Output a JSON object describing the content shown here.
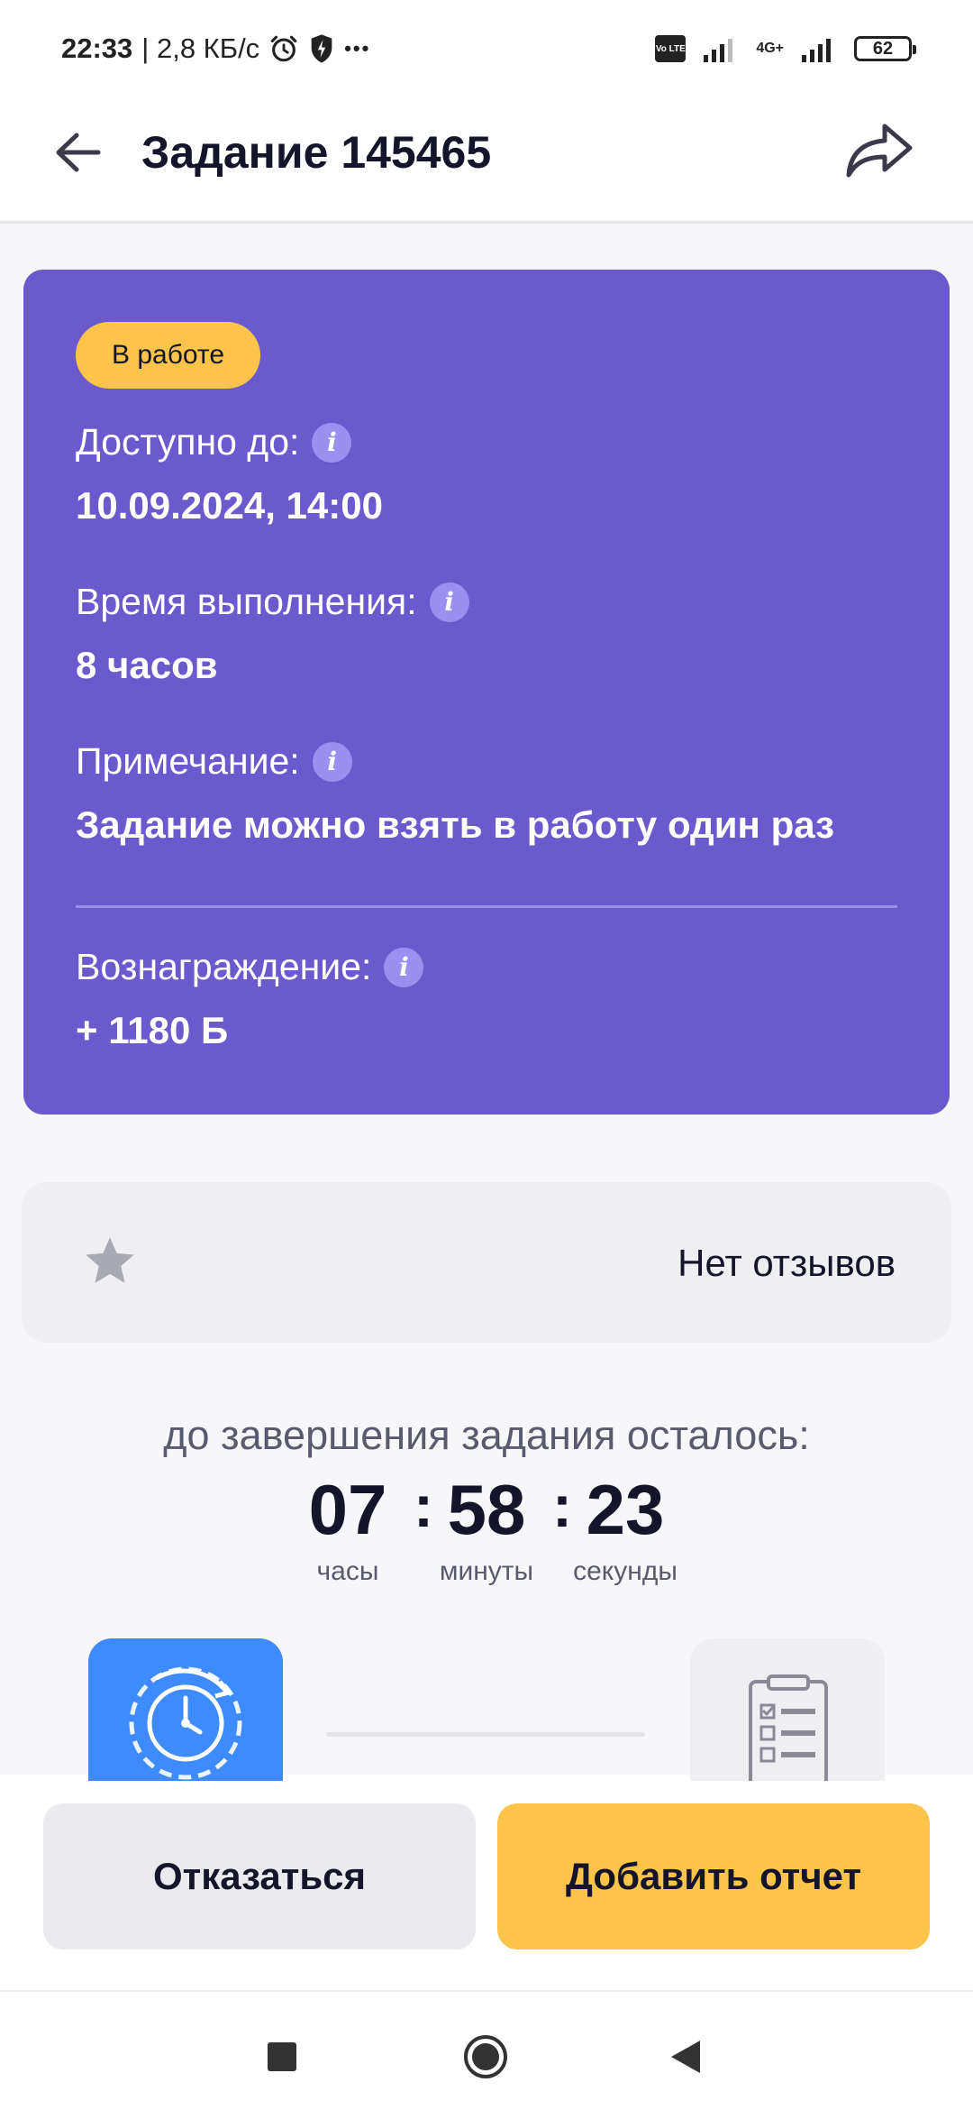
{
  "status_bar": {
    "time": "22:33",
    "speed": "| 2,8 КБ/с",
    "dots": "•••",
    "volte": "Vo LTE",
    "network": "4G+",
    "battery": "62"
  },
  "header": {
    "title": "Задание 145465"
  },
  "task": {
    "badge": "В работе",
    "available_label": "Доступно до:",
    "available_value": "10.09.2024, 14:00",
    "duration_label": "Время выполнения:",
    "duration_value": "8 часов",
    "note_label": "Примечание:",
    "note_value": "Задание можно взять в работу один раз",
    "reward_label": "Вознаграждение:",
    "reward_value": "+ 1180 Б",
    "info_glyph": "i",
    "card_color": "#6a5acd",
    "badge_color": "#fcc44a"
  },
  "reviews": {
    "text": "Нет отзывов"
  },
  "timer": {
    "caption": "до завершения задания осталось:",
    "hours": "07",
    "minutes": "58",
    "seconds": "23",
    "separator": ":",
    "hours_label": "часы",
    "minutes_label": "минуты",
    "seconds_label": "секунды"
  },
  "steps": {
    "current_icon": "clock-refresh-icon",
    "next_icon": "report-checklist-icon"
  },
  "actions": {
    "decline_label": "Отказаться",
    "report_label": "Добавить отчет"
  },
  "icons": {
    "back": "arrow-left-icon",
    "share": "share-icon",
    "star": "star-icon",
    "nav_recents": "square-icon",
    "nav_home": "circle-icon",
    "nav_back": "triangle-icon"
  }
}
